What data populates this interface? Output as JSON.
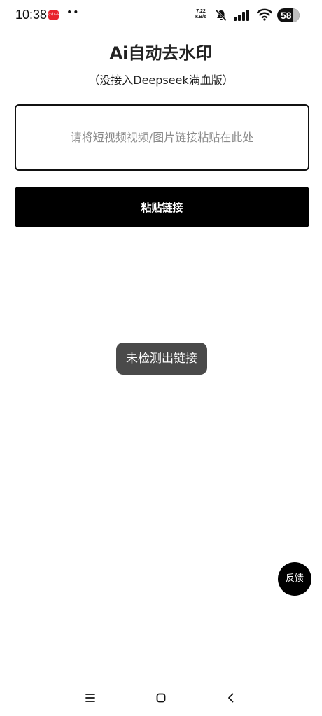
{
  "status_bar": {
    "time": "10:38",
    "app_badge": "小红书",
    "dots": "••",
    "net_speed_value": "7.22",
    "net_speed_unit": "KB/s",
    "battery": "58",
    "icons": [
      "bell-muted-icon",
      "signal-icon",
      "wifi-icon",
      "battery-icon"
    ]
  },
  "header": {
    "title": "Ai自动去水印",
    "subtitle": "（没接入Deepseek满血版）"
  },
  "link_input": {
    "value": "",
    "placeholder": "请将短视频视频/图片链接粘贴在此处"
  },
  "paste_button": {
    "label": "粘贴链接"
  },
  "toast": {
    "message": "未检测出链接"
  },
  "feedback_button": {
    "label": "反馈"
  },
  "nav_bar": {
    "icons": [
      "menu-icon",
      "home-icon",
      "back-icon"
    ]
  },
  "colors": {
    "background": "#ffffff",
    "primary_button": "#000000",
    "toast_background": "#4a4a4a",
    "placeholder_text": "#8a8a8a"
  }
}
